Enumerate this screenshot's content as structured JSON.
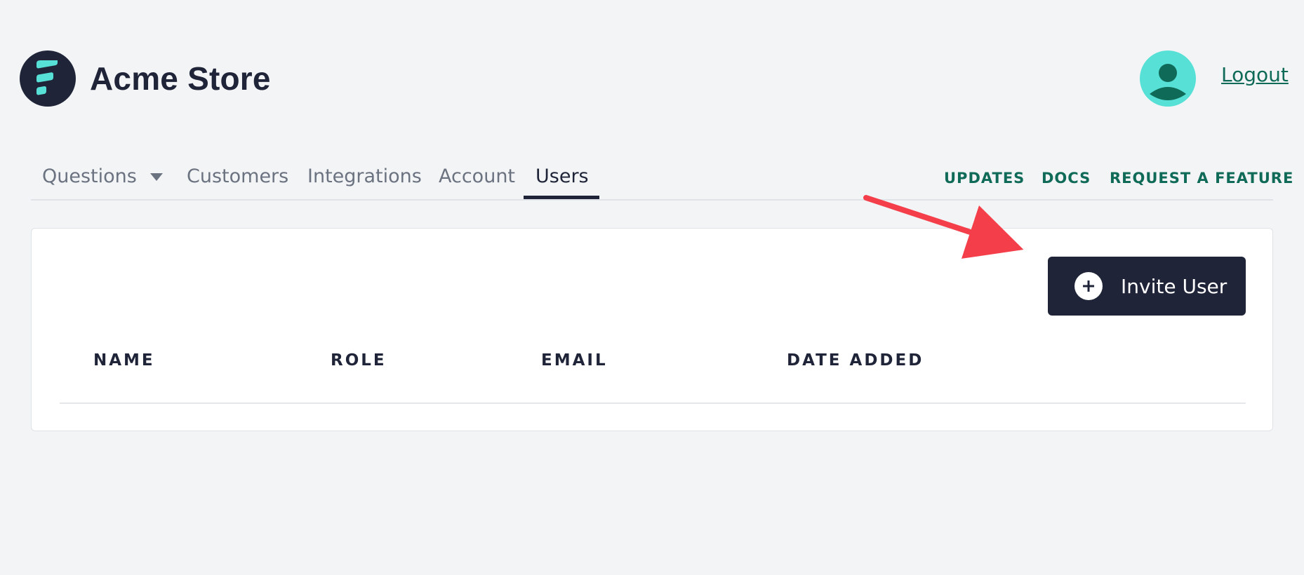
{
  "app": {
    "name": "Acme Store"
  },
  "header": {
    "logout_label": "Logout"
  },
  "nav": {
    "tabs": [
      {
        "label": "Questions",
        "has_dropdown": true
      },
      {
        "label": "Customers"
      },
      {
        "label": "Integrations"
      },
      {
        "label": "Account"
      },
      {
        "label": "Users",
        "active": true
      }
    ],
    "links": [
      {
        "label": "UPDATES"
      },
      {
        "label": "DOCS"
      },
      {
        "label": "REQUEST A FEATURE"
      }
    ]
  },
  "users_panel": {
    "invite_button_label": "Invite User",
    "table": {
      "columns": [
        "NAME",
        "ROLE",
        "EMAIL",
        "DATE ADDED"
      ],
      "rows": []
    }
  },
  "icons": {
    "logo": "brand-logo-icon",
    "avatar": "user-avatar-icon",
    "dropdown": "caret-down-icon",
    "invite": "plus-circle-icon"
  },
  "colors": {
    "brand_dark": "#1f2438",
    "accent_teal": "#57e1d6",
    "link_green": "#0f6a57",
    "annotation_arrow": "#f43f4a"
  }
}
